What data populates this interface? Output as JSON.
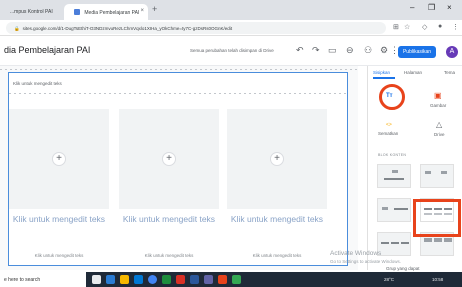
{
  "browser": {
    "tabs": [
      {
        "title": "...mpus Kontrol PAI",
        "close": "×"
      },
      {
        "title": "Media Pembelajaran PAI",
        "close": "×"
      }
    ],
    "new_tab": "+",
    "url": "sites.google.com/d/1-DugTsEthiT-O3NDzmvuRezLChmVqxlo1XIHa_yOkChme=ty7C-gzDsRs0OGnK/edit",
    "window_controls": [
      "–",
      "❐",
      "×"
    ]
  },
  "sites": {
    "title": "dia Pembelajaran PAI",
    "save_status": "Semua perubahan telah disimpan di Drive",
    "publish_label": "Publikasikan",
    "avatar_letter": "A"
  },
  "canvas": {
    "header_text": "Klik untuk mengedit teks",
    "cards": [
      {
        "plus": "+",
        "title": "Klik untuk mengedit teks",
        "body": "Klik untuk mengedit teks"
      },
      {
        "plus": "+",
        "title": "Klik untuk mengedit teks",
        "body": "Klik untuk mengedit teks"
      },
      {
        "plus": "+",
        "title": "Klik untuk mengedit teks",
        "body": "Klik untuk mengedit teks"
      }
    ]
  },
  "panel": {
    "tabs": [
      "Sisipkan",
      "Halaman",
      "Tema"
    ],
    "items": [
      {
        "icon": "text-box-icon",
        "glyph": "Tт",
        "label": "Kotak teks"
      },
      {
        "icon": "image-icon",
        "glyph": "🖼",
        "label": "Gambar"
      },
      {
        "icon": "embed-icon",
        "glyph": "<>",
        "label": "Sematkan"
      },
      {
        "icon": "drive-icon",
        "glyph": "△",
        "label": "Drive"
      }
    ],
    "layouts_heading": "BLOK KONTEN",
    "group_label": "Grup yang dapat"
  },
  "watermark": {
    "line1": "Activate Windows",
    "line2": "Go to Settings to activate Windows."
  },
  "taskbar": {
    "search_placeholder": "e here to search",
    "temperature": "28°C",
    "time": "10:58"
  },
  "colors": {
    "accent": "#1a73e8",
    "highlight": "#e8431b",
    "avatar": "#673ab7"
  }
}
